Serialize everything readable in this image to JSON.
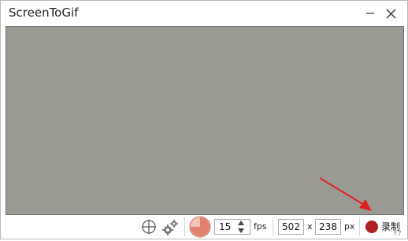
{
  "window": {
    "title": "ScreenToGif"
  },
  "toolbar": {
    "fps_value": "15",
    "fps_label": "fps",
    "width_value": "502",
    "times_label": "x",
    "height_value": "238",
    "px_label": "px",
    "record_label": "录制",
    "record_shortcut": "F7"
  },
  "icons": {
    "minimize": "minimize-icon",
    "close": "close-icon",
    "snap": "crosshair-icon",
    "options": "gears-icon",
    "frequency": "pie-timer-icon",
    "annotation": "red-arrow"
  },
  "colors": {
    "canvas": "#9a9a93",
    "record": "#b0201c",
    "pie": "#e0826b",
    "arrow": "#e02020"
  }
}
